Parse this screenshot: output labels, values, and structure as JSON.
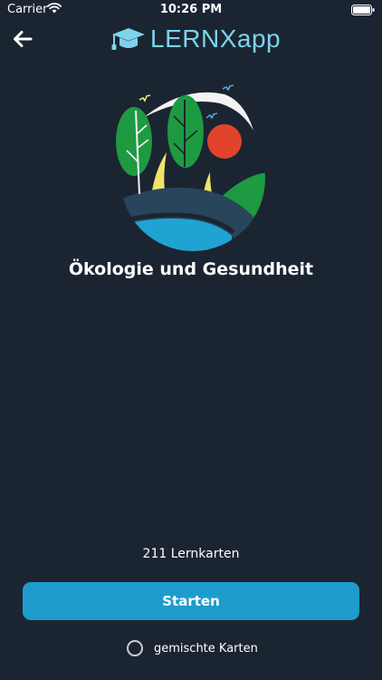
{
  "status_bar": {
    "carrier": "Carrier",
    "time": "10:26 PM",
    "wifi_icon": "wifi-icon",
    "battery_icon": "battery-icon"
  },
  "nav": {
    "back_icon": "arrow-left-icon",
    "logo_icon": "graduation-cap-icon",
    "logo_text": "LERNXapp"
  },
  "topic": {
    "illustration": "nature-landscape-illustration",
    "title": "Ökologie und Gesundheit"
  },
  "footer": {
    "card_count": "211 Lernkarten",
    "start_label": "Starten",
    "mixed_cards_label": "gemischte Karten",
    "mixed_cards_checked": false
  },
  "colors": {
    "background": "#1b2532",
    "accent": "#1d9ccb",
    "logo": "#7dd3ec"
  }
}
